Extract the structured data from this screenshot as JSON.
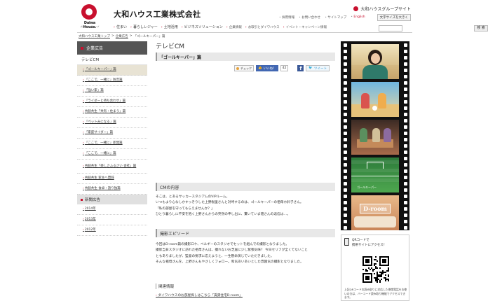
{
  "header": {
    "logo_text": "Daiwa House.",
    "logo_sub": "大和ハウスグループ",
    "company_name": "大和ハウス工業株式会社",
    "group_link": "大和ハウスグループサイト",
    "util_links": [
      "採用情報",
      "お問い合わせ",
      "サイトマップ"
    ],
    "english": "English",
    "char_size": "文字サイズを大きく",
    "nav": [
      {
        "label": "住まい",
        "small": false
      },
      {
        "label": "暮らしレジャー",
        "small": false
      },
      {
        "label": "土地活用",
        "small": false
      },
      {
        "label": "ビジネスソリューション",
        "small": false
      },
      {
        "label": "企業情報",
        "small": true
      },
      {
        "label": "お取引とダイワハウス",
        "small": true
      },
      {
        "label": "イベント・キャンペーン情報",
        "small": true
      }
    ],
    "search_placeholder": "",
    "search_button": "検 索"
  },
  "breadcrumb": {
    "items": [
      "大和ハウス工業トップ",
      "企業広告",
      "「ゴールキーパー」篇"
    ],
    "separator": ">"
  },
  "sidebar": {
    "head": "企業広告",
    "sub": "テレビCM",
    "items": [
      {
        "label": "「ゴールキーパー」篇",
        "active": true,
        "tall": false
      },
      {
        "label": "「ここで、一緒に」防音篇",
        "active": false,
        "tall": false
      },
      {
        "label": "「強い家」篇",
        "active": false,
        "tall": false
      },
      {
        "label": "「ライダーと待ち合わせ」篇",
        "active": false,
        "tall": false
      },
      {
        "label": "共創共生「共有・住まう」篇",
        "active": false,
        "tall": false
      },
      {
        "label": "「ペットみになる」篇",
        "active": false,
        "tall": false
      },
      {
        "label": "「家庭サイダー」篇",
        "active": false,
        "tall": false
      },
      {
        "label": "「ここで、一緒に」即発篇",
        "active": false,
        "tall": false
      },
      {
        "label": "「ここで、一緒に」篇",
        "active": false,
        "tall": false
      },
      {
        "label": "共創共生「楽しさふるさい 会社」篇",
        "active": false,
        "tall": true
      },
      {
        "label": "共創共生 家主へ賛辞",
        "active": false,
        "tall": false
      },
      {
        "label": "共創共生 食卓・語り独篇",
        "active": false,
        "tall": false
      }
    ],
    "head2": "新聞広告",
    "years": [
      "2014年",
      "2013年",
      "2012年"
    ]
  },
  "content": {
    "title": "テレビCM",
    "cm_title": "「ゴールキーパー」篇",
    "share": {
      "check": "チェック",
      "like": "いいね！",
      "like_count": "42",
      "fb": "f",
      "tweet": "ツイート"
    },
    "section1": "CMの内容",
    "para1": [
      "そこは、とあるサッカースタジアムのVIPルーム。",
      "いつもより心なしかすっきりした上野樹里さんと対峙するのは、ゴールキーパーの祖母ホ鈴子さん。",
      "「私の部屋を守ってもらえませんか？」",
      "ひとり暮らしに不安を抱く上野さんからの突然の申し出に、驚いていま雑さんの返信は…。"
    ],
    "section2": "撮影エピソード",
    "para2": [
      "今回はD-room篇の撮影ロケ、ベルギーのスタジオでセットを組んでの撮影となりました。",
      "撮影当日スタジオに訪れた祖母さんは、撮れないお芝居に少し緊張気味？ 今日セリフが全くてないこと",
      "ともありましたが、監督の要求に応えようと、一生懸命演じていただきました。",
      "そんな祖母さんを、上野さんもやさしくフォロー。和気あいあいとした雰囲気の撮影となりました。"
    ],
    "related_head": "関連情報",
    "related_link": "ダイワハウスのお部屋探しはこちら「賃貸住宅D-room」"
  },
  "film": {
    "frame5_label": "D-room",
    "frame4_caption": "ゴールキーパー"
  },
  "qr": {
    "title": [
      "QRコードで",
      "携帯サイトにアクセス！"
    ],
    "note": "上記QRコードの読み取りに対応した携帯電話をお使いの方は、バーコード読み取り機能でアクセスできます。"
  }
}
